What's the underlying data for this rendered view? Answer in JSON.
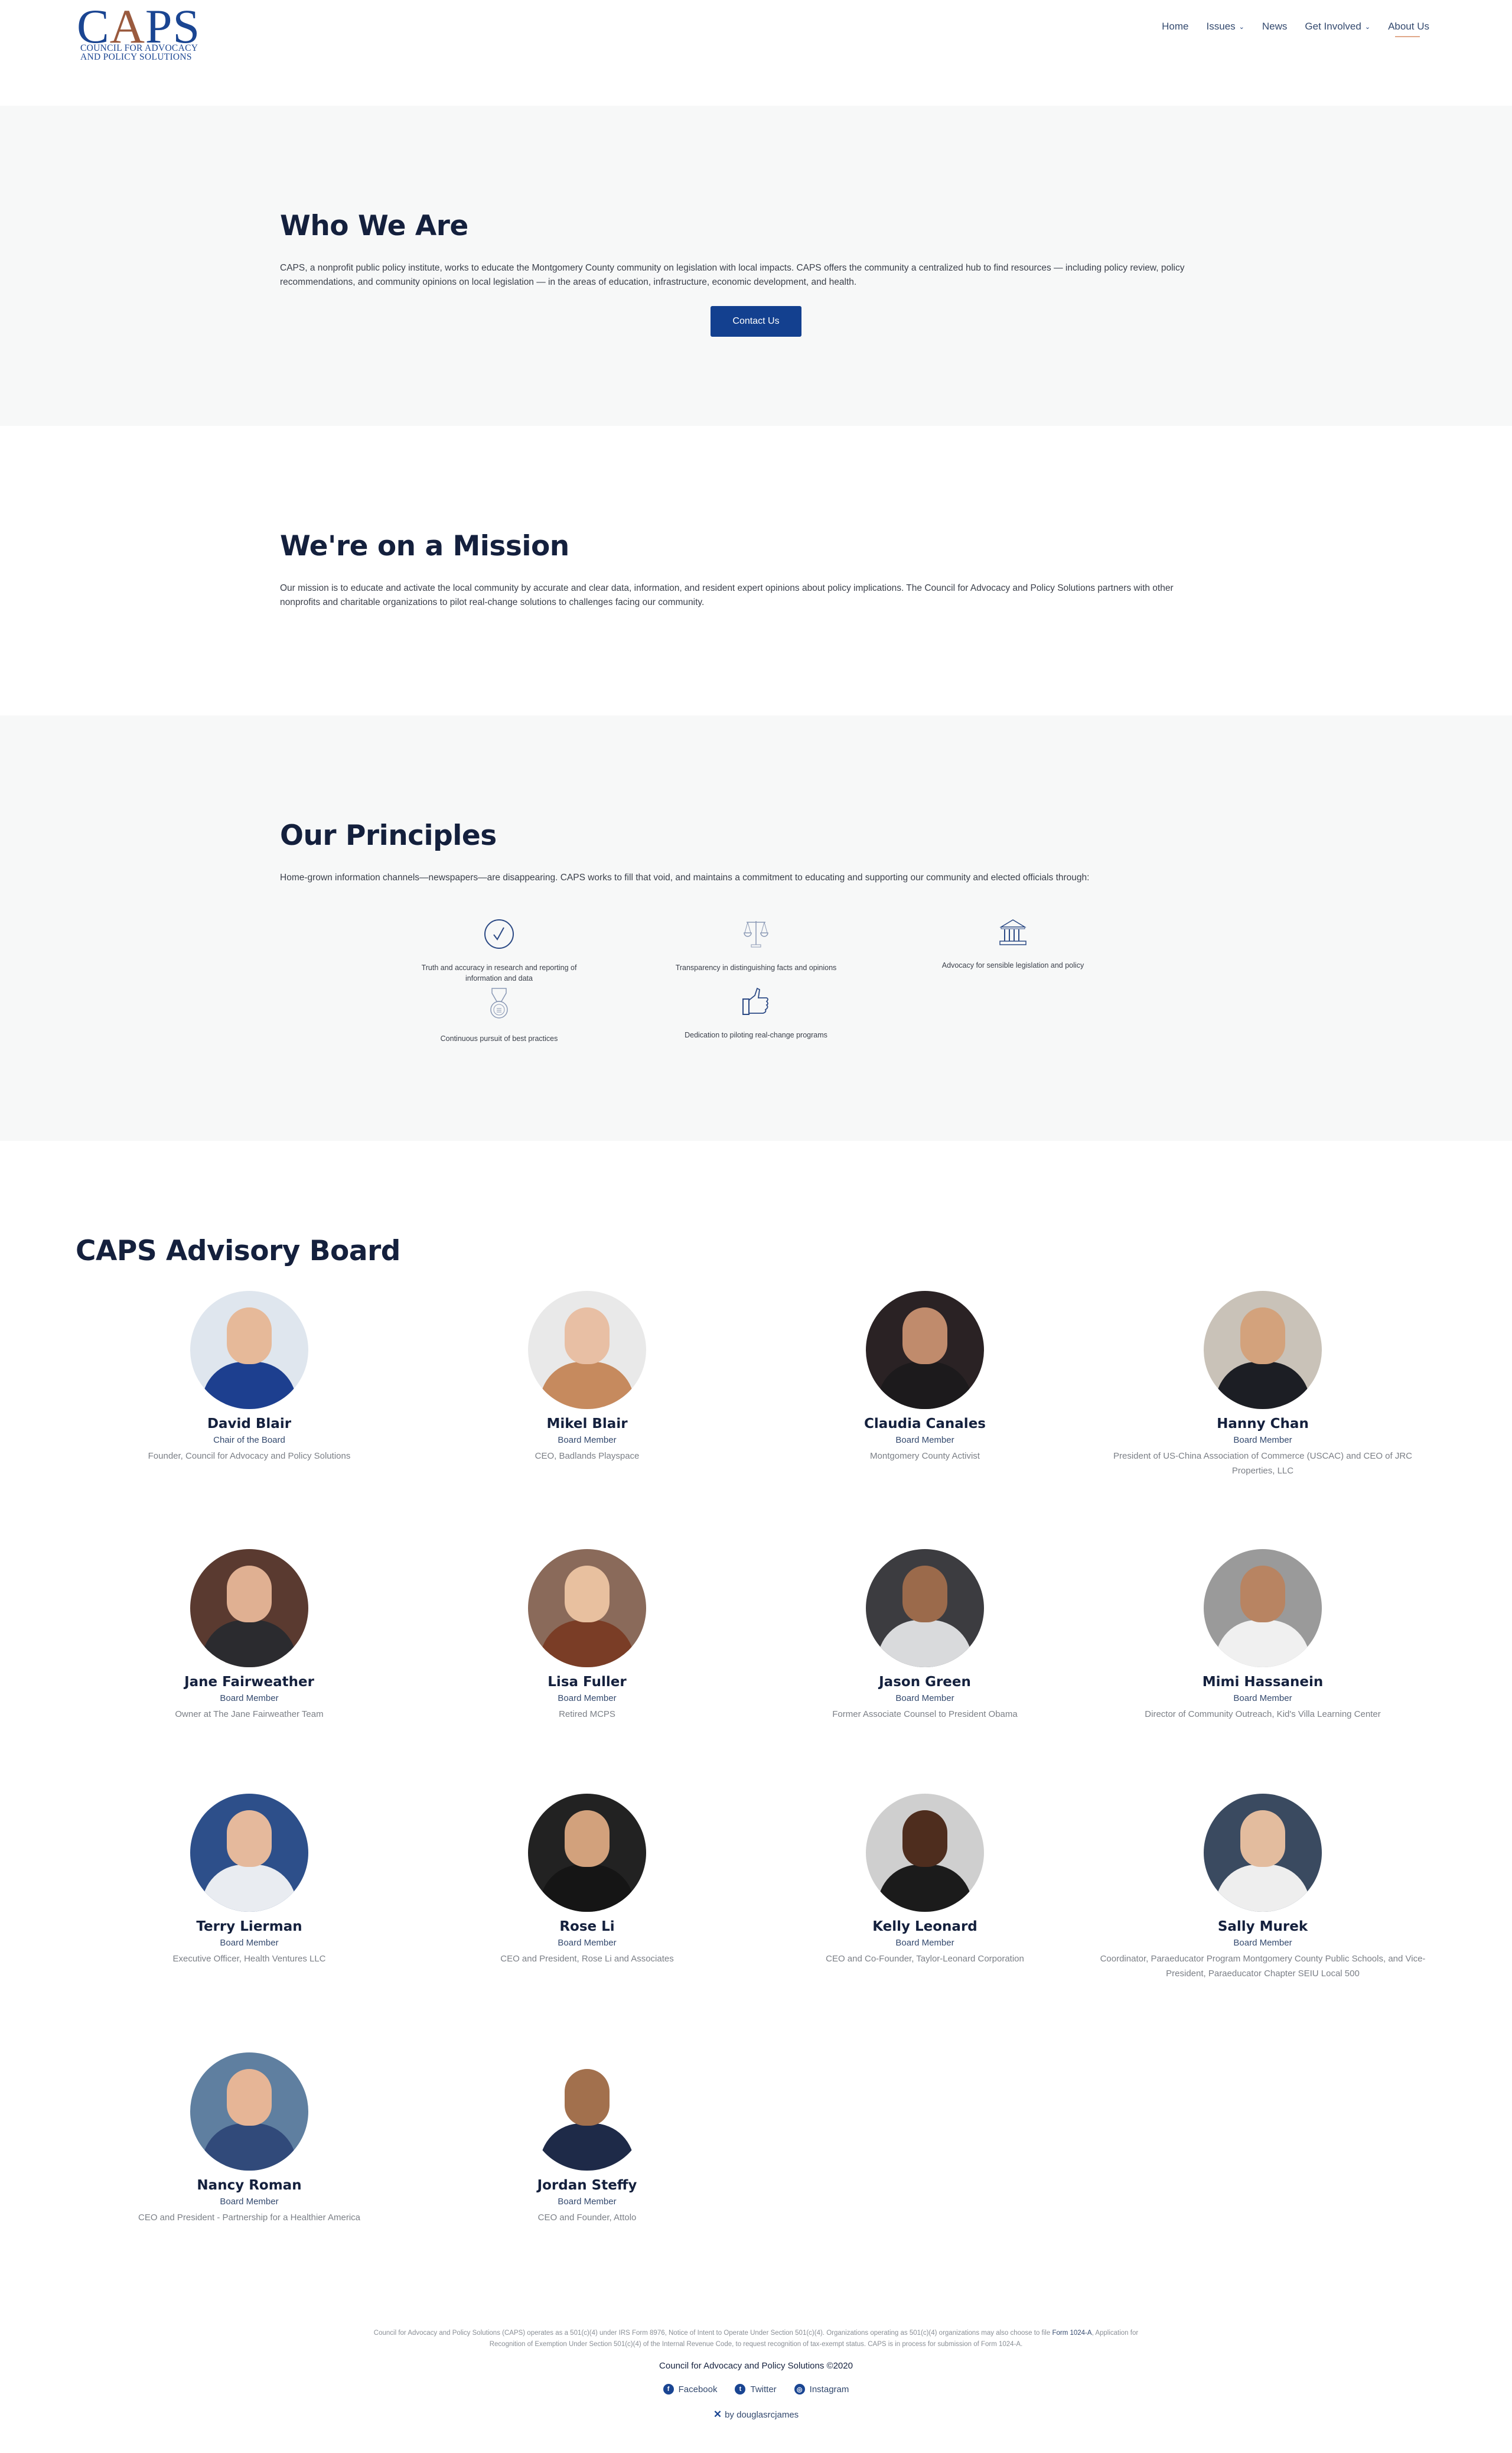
{
  "header": {
    "logo": {
      "letters": [
        "C",
        "A",
        "P",
        "S"
      ],
      "subtitle_line1": "COUNCIL FOR ADVOCACY",
      "subtitle_line2": "AND POLICY SOLUTIONS"
    },
    "nav": [
      {
        "label": "Home",
        "has_dropdown": false
      },
      {
        "label": "Issues",
        "has_dropdown": true
      },
      {
        "label": "News",
        "has_dropdown": false
      },
      {
        "label": "Get Involved",
        "has_dropdown": true
      },
      {
        "label": "About Us",
        "has_dropdown": false,
        "active": true
      }
    ],
    "chevron": "⌄"
  },
  "who": {
    "title": "Who We Are",
    "text": "CAPS, a nonprofit public policy institute, works to educate the Montgomery County community on legislation with local impacts. CAPS offers the community a centralized hub to find resources — including policy review, policy recommendations, and community opinions on local legislation — in the areas of education, infrastructure, economic development, and health.",
    "button": "Contact Us"
  },
  "mission": {
    "title": "We're on a Mission",
    "text": "Our mission is to educate and activate the local community by accurate and clear data, information, and resident expert opinions about policy implications.  The Council for Advocacy and Policy Solutions partners with other nonprofits and charitable organizations to pilot real-change solutions to challenges facing our community."
  },
  "principles": {
    "title": "Our Principles",
    "text": "Home-grown information channels—newspapers—are disappearing. CAPS works to fill that void, and maintains a commitment to educating and supporting our community and elected officials through:",
    "items": [
      {
        "icon": "check-circle-icon",
        "text": "Truth and accuracy in research and reporting of information and data"
      },
      {
        "icon": "scales-icon",
        "text": "Transparency in distinguishing facts and opinions"
      },
      {
        "icon": "capitol-building-icon",
        "text": "Advocacy for sensible legislation and policy"
      },
      {
        "icon": "medal-icon",
        "text": "Continuous pursuit of best practices"
      },
      {
        "icon": "thumbs-up-icon",
        "text": "Dedication to piloting real-change programs"
      }
    ]
  },
  "board": {
    "title": "CAPS Advisory Board",
    "members": [
      {
        "name": "David Blair",
        "role": "Chair of the Board",
        "desc": "Founder, Council for Advocacy and Policy Solutions"
      },
      {
        "name": "Mikel Blair",
        "role": "Board Member",
        "desc": "CEO, Badlands Playspace"
      },
      {
        "name": "Claudia Canales",
        "role": "Board Member",
        "desc": "Montgomery County Activist"
      },
      {
        "name": "Hanny Chan",
        "role": "Board Member",
        "desc": "President of US-China Association of Commerce (USCAC) and CEO of JRC Properties, LLC"
      },
      {
        "name": "Jane Fairweather",
        "role": "Board Member",
        "desc": "Owner at The Jane Fairweather Team"
      },
      {
        "name": "Lisa Fuller",
        "role": "Board Member",
        "desc": "Retired MCPS"
      },
      {
        "name": "Jason Green",
        "role": "Board Member",
        "desc": "Former Associate Counsel to President Obama"
      },
      {
        "name": "Mimi Hassanein",
        "role": "Board Member",
        "desc": "Director of Community Outreach, Kid's Villa Learning Center"
      },
      {
        "name": "Terry Lierman",
        "role": "Board Member",
        "desc": "Executive Officer, Health Ventures LLC"
      },
      {
        "name": "Rose Li",
        "role": "Board Member",
        "desc": "CEO and President, Rose Li and Associates"
      },
      {
        "name": "Kelly Leonard",
        "role": "Board Member",
        "desc": "CEO and Co-Founder, Taylor-Leonard Corporation"
      },
      {
        "name": "Sally Murek",
        "role": "Board Member",
        "desc": "Coordinator, Paraeducator Program Montgomery County Public Schools, and Vice-President, Paraeducator Chapter SEIU Local 500"
      },
      {
        "name": "Nancy Roman",
        "role": "Board Member",
        "desc": "CEO and President - Partnership for a Healthier America"
      },
      {
        "name": "Jordan Steffy",
        "role": "Board Member",
        "desc": "CEO and Founder, Attolo"
      }
    ]
  },
  "footer": {
    "legal_part1": "Council for Advocacy and Policy Solutions (CAPS) operates as a 501(c)(4) under IRS Form 8976, Notice of Intent to Operate Under Section 501(c)(4). Organizations operating as 501(c)(4) organizations may also choose to file ",
    "legal_link": "Form 1024-A",
    "legal_part2": ", Application for Recognition of Exemption Under Section 501(c)(4) of the Internal Revenue Code, to request recognition of tax-exempt status. CAPS is in process for submission of Form 1024-A.",
    "copyright": "Council for Advocacy and Policy Solutions   ©2020",
    "social": [
      {
        "label": "Facebook",
        "icon": "facebook-icon",
        "glyph": "f"
      },
      {
        "label": "Twitter",
        "icon": "twitter-icon",
        "glyph": "t"
      },
      {
        "label": "Instagram",
        "icon": "instagram-icon",
        "glyph": "◎"
      }
    ],
    "credit": "by douglasrcjames",
    "credit_icon": "tools-icon"
  },
  "colors": {
    "brand_blue": "#13408f",
    "brand_copper": "#9a5a3e",
    "heading": "#14203d",
    "section_gray": "#f7f8f8",
    "active_underline": "#e0a88a"
  }
}
